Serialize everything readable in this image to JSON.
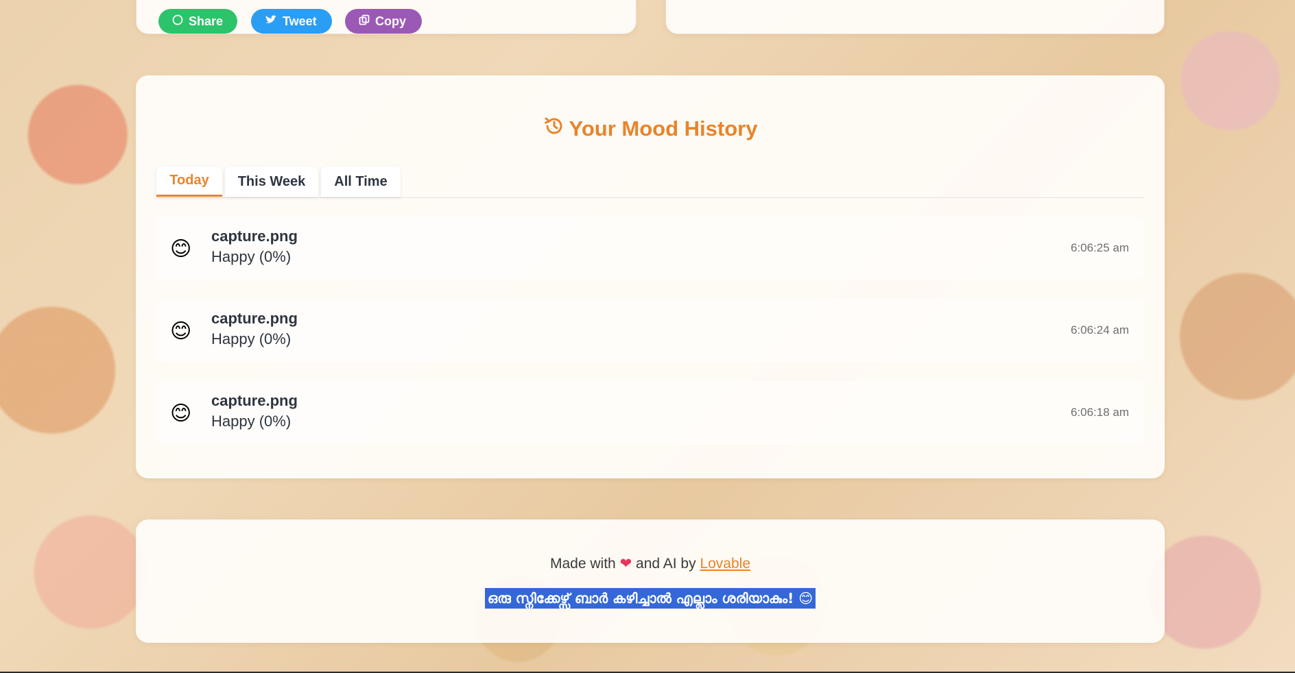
{
  "share": {
    "share_label": "Share",
    "tweet_label": "Tweet",
    "copy_label": "Copy"
  },
  "history": {
    "title": "Your Mood History",
    "tabs": [
      {
        "label": "Today",
        "active": true
      },
      {
        "label": "This Week",
        "active": false
      },
      {
        "label": "All Time",
        "active": false
      }
    ],
    "entries": [
      {
        "emoji": "😊",
        "file": "capture.png",
        "mood": "Happy (0%)",
        "time": "6:06:25 am"
      },
      {
        "emoji": "😊",
        "file": "capture.png",
        "mood": "Happy (0%)",
        "time": "6:06:24 am"
      },
      {
        "emoji": "😊",
        "file": "capture.png",
        "mood": "Happy (0%)",
        "time": "6:06:18 am"
      }
    ]
  },
  "footer": {
    "made_with_prefix": "Made with",
    "heart": "❤",
    "made_with_suffix": "and AI by",
    "link_text": "Lovable",
    "tagline": "ഒരു സ്നിക്കേഴ്സ് ബാർ കഴിച്ചാൽ എല്ലാം ശരിയാകും! 😊"
  },
  "colors": {
    "accent": "#e8842a",
    "share_green": "#2cc36b",
    "tweet_blue": "#2a9df4",
    "copy_purple": "#9b59b6",
    "selection_blue": "#3468d8"
  },
  "icons": {
    "title_icon": "history-icon",
    "share_icon": "whatsapp-icon",
    "tweet_icon": "twitter-icon",
    "copy_icon": "copy-icon"
  }
}
